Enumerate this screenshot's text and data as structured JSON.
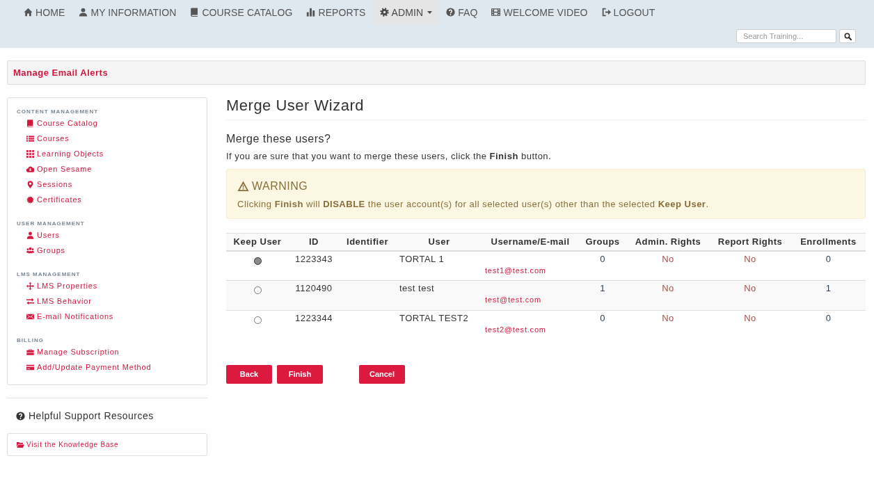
{
  "nav": {
    "items": [
      {
        "label": "HOME",
        "selected": false,
        "dropdown": false
      },
      {
        "label": "MY INFORMATION",
        "selected": false,
        "dropdown": false
      },
      {
        "label": "COURSE CATALOG",
        "selected": false,
        "dropdown": false
      },
      {
        "label": "REPORTS",
        "selected": false,
        "dropdown": false
      },
      {
        "label": "ADMIN",
        "selected": true,
        "dropdown": true
      },
      {
        "label": "FAQ",
        "selected": false,
        "dropdown": false
      },
      {
        "label": "WELCOME VIDEO",
        "selected": false,
        "dropdown": false
      },
      {
        "label": "LOGOUT",
        "selected": false,
        "dropdown": false
      }
    ]
  },
  "search": {
    "placeholder": "Search Training..."
  },
  "page_banner": {
    "title": "Manage Email Alerts"
  },
  "sidebar": {
    "sections": [
      {
        "heading": "CONTENT MANAGEMENT",
        "items": [
          {
            "label": "Course Catalog"
          },
          {
            "label": "Courses"
          },
          {
            "label": "Learning Objects"
          },
          {
            "label": "Open Sesame"
          },
          {
            "label": "Sessions"
          },
          {
            "label": "Certificates"
          }
        ]
      },
      {
        "heading": "USER MANAGEMENT",
        "items": [
          {
            "label": "Users"
          },
          {
            "label": "Groups"
          }
        ]
      },
      {
        "heading": "LMS MANAGEMENT",
        "items": [
          {
            "label": "LMS Properties"
          },
          {
            "label": "LMS Behavior"
          },
          {
            "label": "E-mail Notifications"
          }
        ]
      },
      {
        "heading": "BILLING",
        "items": [
          {
            "label": "Manage Subscription"
          },
          {
            "label": "Add/Update Payment Method"
          }
        ]
      }
    ]
  },
  "support": {
    "heading": "Helpful Support Resources",
    "link": "Visit the Knowledge Base"
  },
  "wizard": {
    "title": "Merge User Wizard",
    "subtitle": "Merge these users?",
    "intro": "If you are sure that you want to merge these users, click the **Finish** button.",
    "warning": {
      "heading": "WARNING",
      "text": "Clicking **Finish** will **DISABLE** the user account(s) for all selected user(s) other than the selected **Keep User**."
    },
    "table": {
      "columns": [
        "Keep User",
        "ID",
        "Identifier",
        "User",
        "Username/E-mail",
        "Groups",
        "Admin. Rights",
        "Report Rights",
        "Enrollments"
      ],
      "rows": [
        {
          "selected": true,
          "id": "1223343",
          "user": "TORTAL 1",
          "email": "test1@test.com",
          "groups": "0",
          "admin_rights": "No",
          "report_rights": "No",
          "enrollments": "0"
        },
        {
          "selected": false,
          "id": "1120490",
          "user": "test test",
          "email": "test@test.com",
          "groups": "1",
          "admin_rights": "No",
          "report_rights": "No",
          "enrollments": "1"
        },
        {
          "selected": false,
          "id": "1223344",
          "user": "TORTAL TEST2",
          "email": "test2@test.com",
          "groups": "0",
          "admin_rights": "No",
          "report_rights": "No",
          "enrollments": "0"
        }
      ]
    },
    "buttons": [
      "Back",
      "Finish"
    ],
    "cancel_button": "Cancel"
  }
}
